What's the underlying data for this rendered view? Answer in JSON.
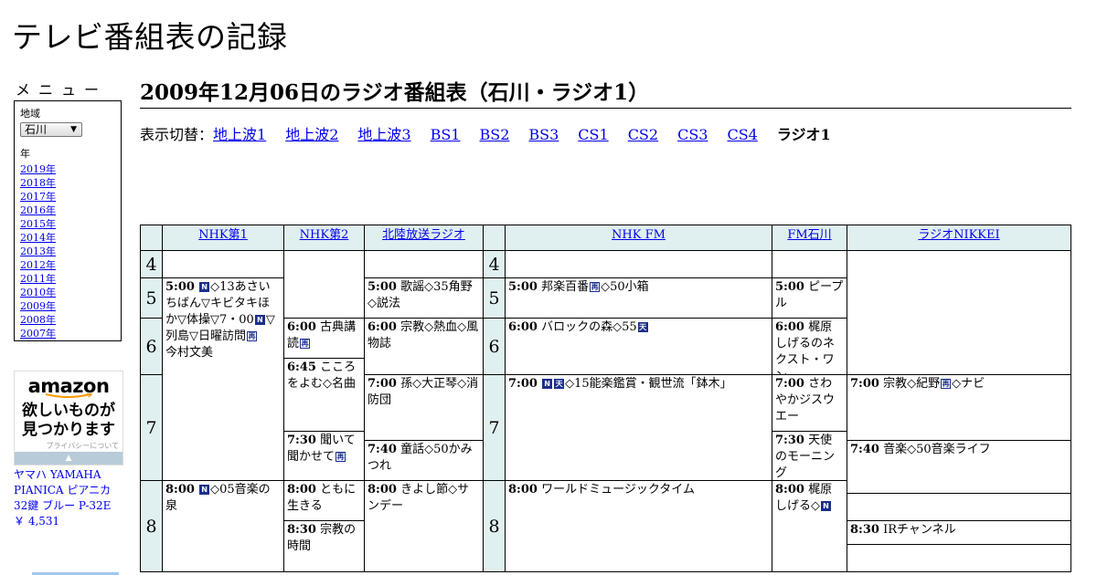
{
  "site": {
    "title": "テレビ番組表の記録"
  },
  "menu": {
    "title": "メニュー",
    "region_label": "地域",
    "region_value": "石川",
    "year_label": "年",
    "years": [
      "2019年",
      "2018年",
      "2017年",
      "2016年",
      "2015年",
      "2014年",
      "2013年",
      "2012年",
      "2011年",
      "2010年",
      "2009年",
      "2008年",
      "2007年"
    ]
  },
  "ad": {
    "logo": "amazon",
    "headline": "欲しいものが\n見つかります",
    "privacy": "プライバシーについて",
    "product": "ヤマハ YAMAHA PIANICA ピアニカ 32鍵 ブルー P-32E",
    "price": "￥ 4,531"
  },
  "heading": "2009年12月06日のラジオ番組表（石川・ラジオ1）",
  "switcher": {
    "label": "表示切替：",
    "links": [
      "地上波1",
      "地上波2",
      "地上波3",
      "BS1",
      "BS2",
      "BS3",
      "CS1",
      "CS2",
      "CS3",
      "CS4"
    ],
    "current": "ラジオ1"
  },
  "badge_legend": {
    "N": "N",
    "ten": "天",
    "sai": "再"
  },
  "schedule": {
    "stations": [
      "NHK第1",
      "NHK第2",
      "北陸放送ラジオ",
      "NHK FM",
      "FM石川",
      "ラジオNIKKEI"
    ],
    "hours": [
      "4",
      "5",
      "6",
      "7",
      "8"
    ],
    "programs": [
      {
        "id": "nhk1-0500",
        "time": "5:00",
        "parts": [
          [
            "N",
            "badge"
          ],
          [
            "◇13あさいちばん▽キビタキほか▽体操▽7・00",
            ""
          ],
          [
            "N",
            "badge"
          ],
          [
            "▽列島▽日曜訪問",
            ""
          ],
          [
            "再",
            "outline"
          ],
          [
            "　今村文美",
            ""
          ]
        ]
      },
      {
        "id": "nhk1-0800",
        "time": "8:00",
        "parts": [
          [
            "N",
            "badge"
          ],
          [
            "◇05音楽の泉",
            ""
          ]
        ]
      },
      {
        "id": "nhk2-0600",
        "time": "6:00",
        "parts": [
          [
            "古典講読",
            ""
          ],
          [
            "再",
            "outline"
          ]
        ]
      },
      {
        "id": "nhk2-0645",
        "time": "6:45",
        "parts": [
          [
            "こころをよむ◇名曲",
            ""
          ]
        ]
      },
      {
        "id": "nhk2-0730",
        "time": "7:30",
        "parts": [
          [
            "聞いて聞かせて",
            ""
          ],
          [
            "再",
            "outline"
          ]
        ]
      },
      {
        "id": "nhk2-0800",
        "time": "8:00",
        "parts": [
          [
            "ともに生きる",
            ""
          ]
        ]
      },
      {
        "id": "nhk2-0830",
        "time": "8:30",
        "parts": [
          [
            "宗教の時間",
            ""
          ]
        ]
      },
      {
        "id": "mro-0500",
        "time": "5:00",
        "parts": [
          [
            "歌謡◇35角野◇説法",
            ""
          ]
        ]
      },
      {
        "id": "mro-0600",
        "time": "6:00",
        "parts": [
          [
            "宗教◇熱血◇風物誌",
            ""
          ]
        ]
      },
      {
        "id": "mro-0700",
        "time": "7:00",
        "parts": [
          [
            "孫◇大正琴◇消防団",
            ""
          ]
        ]
      },
      {
        "id": "mro-0740",
        "time": "7:40",
        "parts": [
          [
            "童話◇50かみつれ",
            ""
          ]
        ]
      },
      {
        "id": "mro-0800",
        "time": "8:00",
        "parts": [
          [
            "きよし節◇サンデー",
            ""
          ]
        ]
      },
      {
        "id": "fm-0500",
        "time": "5:00",
        "parts": [
          [
            "邦楽百番",
            ""
          ],
          [
            "再",
            "outline"
          ],
          [
            "◇50小箱",
            ""
          ]
        ]
      },
      {
        "id": "fm-0600",
        "time": "6:00",
        "parts": [
          [
            "バロックの森◇55",
            ""
          ],
          [
            "天",
            "badge"
          ]
        ]
      },
      {
        "id": "fm-0700",
        "time": "7:00",
        "parts": [
          [
            "N",
            "badge"
          ],
          [
            "天",
            "badge"
          ],
          [
            "◇15能楽鑑賞・観世流「鉢木」",
            ""
          ]
        ]
      },
      {
        "id": "fm-0800",
        "time": "8:00",
        "parts": [
          [
            "ワールドミュージックタイム",
            ""
          ]
        ]
      },
      {
        "id": "fmi-0500",
        "time": "5:00",
        "parts": [
          [
            "ピープル",
            ""
          ]
        ]
      },
      {
        "id": "fmi-0600",
        "time": "6:00",
        "parts": [
          [
            "梶原しげるのネクスト・ワン",
            ""
          ]
        ]
      },
      {
        "id": "fmi-0700",
        "time": "7:00",
        "parts": [
          [
            "さわやかジスウエー",
            ""
          ]
        ]
      },
      {
        "id": "fmi-0730",
        "time": "7:30",
        "parts": [
          [
            "天使のモーニング",
            ""
          ]
        ]
      },
      {
        "id": "fmi-0800",
        "time": "8:00",
        "parts": [
          [
            "梶原しげる◇",
            ""
          ],
          [
            "N",
            "badge"
          ]
        ]
      },
      {
        "id": "nikkei-0700",
        "time": "7:00",
        "parts": [
          [
            "宗教◇紀野",
            ""
          ],
          [
            "再",
            "outline"
          ],
          [
            "◇ナビ",
            ""
          ]
        ]
      },
      {
        "id": "nikkei-0740",
        "time": "7:40",
        "parts": [
          [
            "音楽◇50音楽ライフ",
            ""
          ]
        ]
      },
      {
        "id": "nikkei-0830",
        "time": "8:30",
        "parts": [
          [
            "IRチャンネル",
            ""
          ]
        ]
      }
    ]
  }
}
